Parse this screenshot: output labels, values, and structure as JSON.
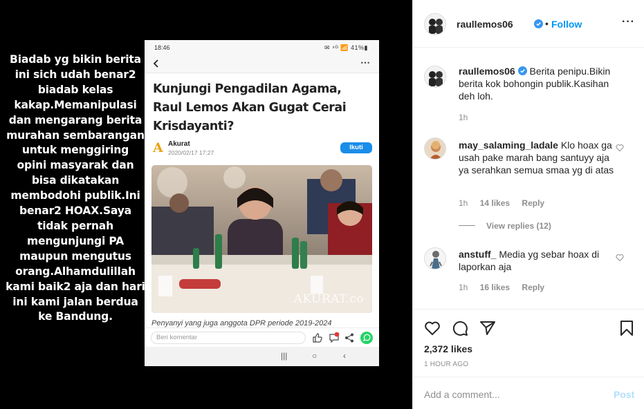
{
  "post_image": {
    "overlay_caption": "Biadab yg bikin berita\nini sich udah benar2\nbiadab kelas\nkakap.Memanipulasi\ndan mengarang berita\nmurahan sembarangan\nuntuk menggiring\nopini masyarak dan\nbisa dikatakan\nmembodohi publik.Ini\nbenar2 HOAX.Saya\ntidak pernah\nmengunjungi PA\nmaupun mengutus\norang.Alhamdulillah\nkami baik2 aja dan hari\nini kami jalan berdua\nke Bandung.",
    "phone": {
      "status_time": "18:46",
      "status_icons": "✉ ⁴ᴳ 📶 41%▮",
      "article_title": "Kunjungi Pengadilan Agama, Raul Lemos Akan Gugat Cerai Krisdayanti?",
      "publisher_logo": "A",
      "publisher_name": "Akurat",
      "publish_date": "2020/02/17 17:27",
      "follow_label": "Ikuti",
      "photo_watermark": "AKURAT.co",
      "photo_caption": "Penyanyi yang juga anggota DPR periode 2019-2024",
      "comment_placeholder": "Beri komentar",
      "comment_badge": "0"
    }
  },
  "header": {
    "username": "raullemos06",
    "dot": "•",
    "follow_label": "Follow",
    "more": "···"
  },
  "comments": [
    {
      "username": "raullemos06",
      "text": "Berita penipu.Bikin berita kok bohongin publik.Kasihan deh loh.",
      "time": "1h"
    },
    {
      "username": "may_salaming_ladale",
      "text": "Klo hoax ga usah pake marah bang santuyy aja ya serahkan semua smaa yg di atas",
      "time": "1h",
      "likes": "14 likes",
      "reply": "Reply",
      "view_replies": "View replies (12)"
    },
    {
      "username": "anstuff_",
      "text": "Media yg sebar hoax di laporkan aja",
      "time": "1h",
      "likes": "16 likes",
      "reply": "Reply"
    }
  ],
  "actions": {
    "likes": "2,372 likes",
    "time_ago": "1 HOUR AGO"
  },
  "add_comment": {
    "placeholder": "Add a comment...",
    "post_label": "Post"
  },
  "colors": {
    "accent": "#0095f6",
    "post_disabled": "#b2dffc",
    "secondary_text": "#8e8e8e"
  }
}
